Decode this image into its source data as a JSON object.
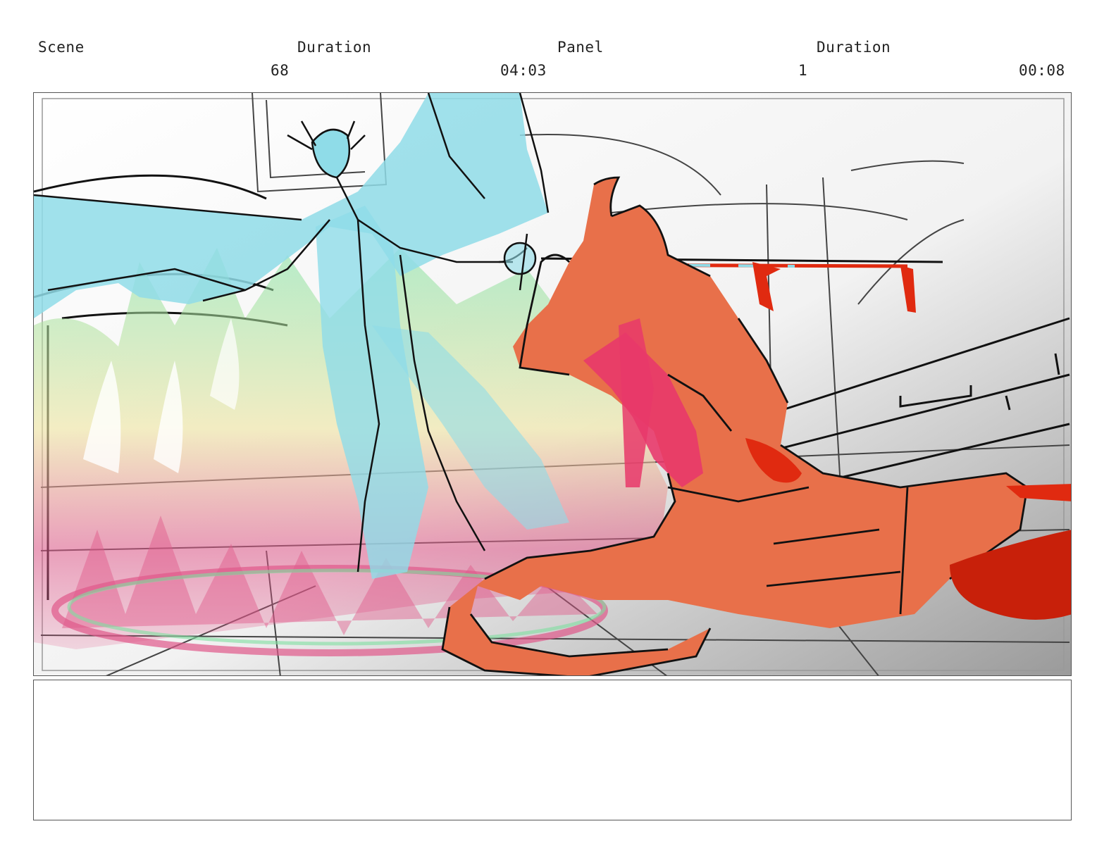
{
  "header": {
    "scene_label": "Scene",
    "duration_label_1": "Duration",
    "panel_label": "Panel",
    "duration_label_2": "Duration",
    "scene_value": "68",
    "scene_duration_value": "04:03",
    "panel_value": "1",
    "panel_duration_value": "00:08"
  },
  "artwork": {
    "icon": "storyboard-sketch",
    "colors": {
      "winged_figure": "#8fdce8",
      "demon_figure": "#e8704a",
      "sash": "#e8386a",
      "blood": "#e02a10",
      "magic_pink": "#e0588a",
      "magic_green": "#7fe0a0",
      "magic_yellow": "#f0e6a0",
      "line": "#111111"
    }
  },
  "notes": {
    "text": ""
  }
}
